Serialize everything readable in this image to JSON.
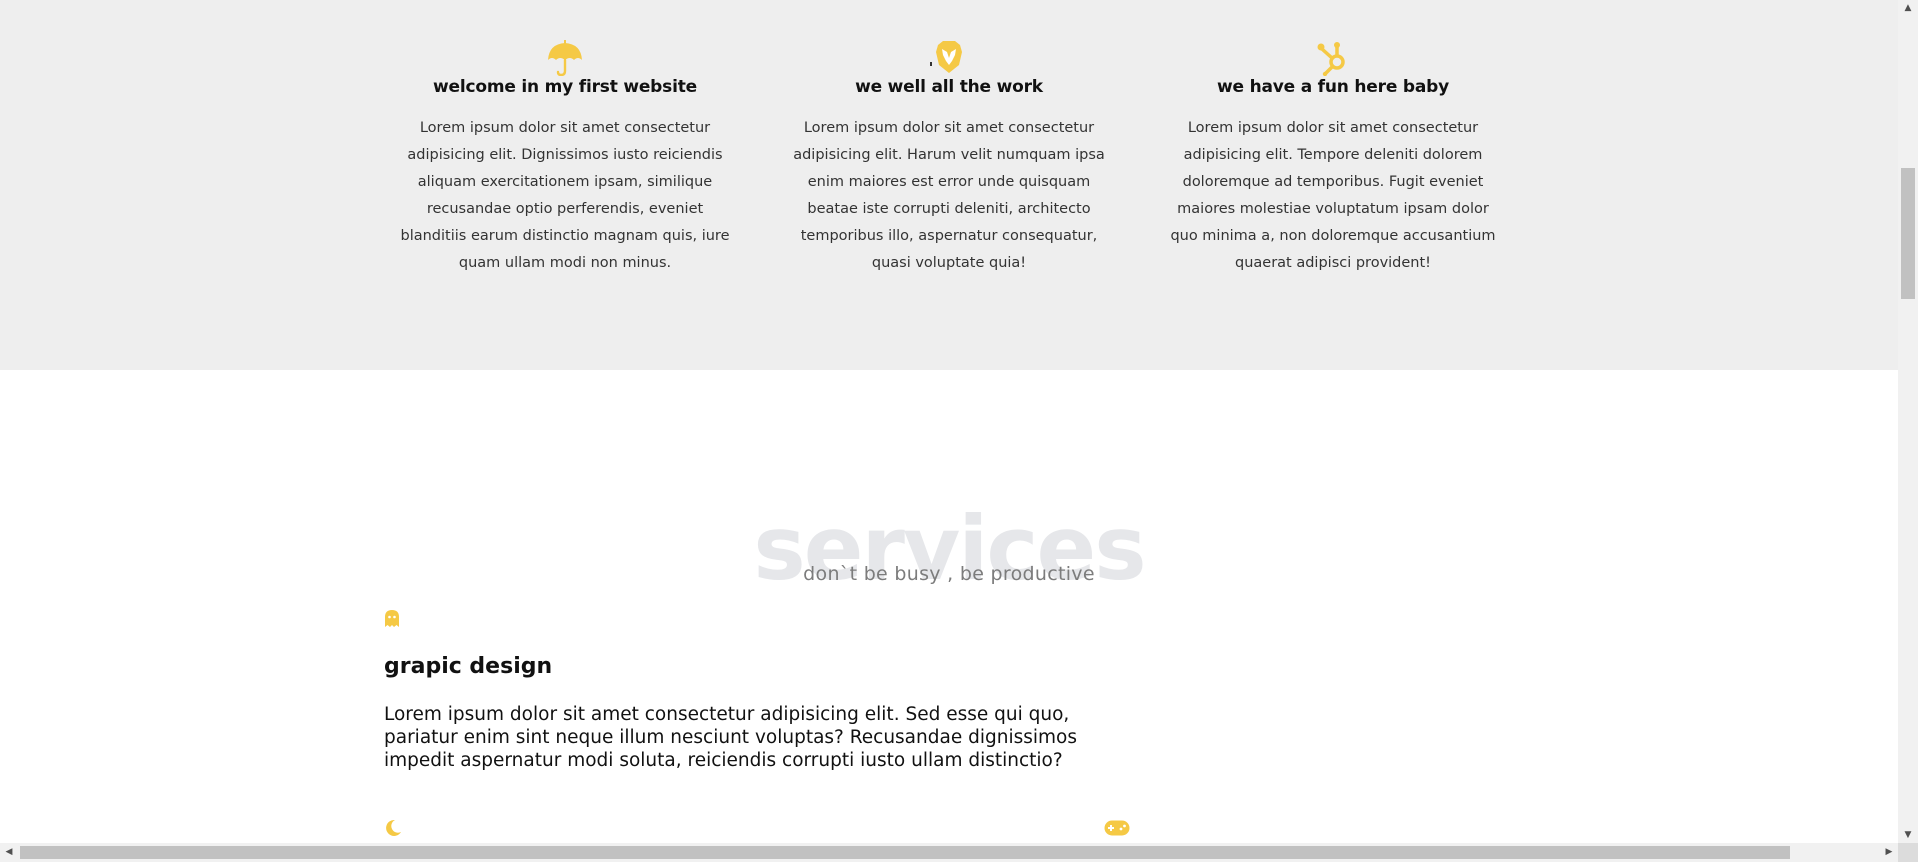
{
  "colors": {
    "accent": "#f5c945",
    "section_bg": "#eeeeee",
    "title_ghost": "#e6e7ea"
  },
  "features": [
    {
      "icon": "umbrella-icon",
      "title": "welcome in my first website",
      "text": "Lorem ipsum dolor sit amet consectetur adipisicing elit. Dignissimos iusto reiciendis aliquam exercitationem ipsam, similique recusandae optio perferendis, eveniet blanditiis earum distinctio magnam quis, iure quam ullam modi non minus."
    },
    {
      "icon": "lion-shield-icon",
      "title": "we well all the work",
      "text": "Lorem ipsum dolor sit amet consectetur adipisicing elit. Harum velit numquam ipsa enim maiores est error unde quisquam beatae iste corrupti deleniti, architecto temporibus illo, aspernatur consequatur, quasi voluptate quia!"
    },
    {
      "icon": "hubspot-icon",
      "title": "we have a fun here baby",
      "text": "Lorem ipsum dolor sit amet consectetur adipisicing elit. Tempore deleniti dolorem doloremque ad temporibus. Fugit eveniet maiores molestiae voluptatum ipsam dolor quo minima a, non doloremque accusantium quaerat adipisci provident!"
    }
  ],
  "services": {
    "title": "services",
    "subtitle": "don`t be busy , be productive",
    "items": [
      {
        "icon": "ghost-icon",
        "title": "grapic design",
        "text": "Lorem ipsum dolor sit amet consectetur adipisicing elit. Sed esse qui quo, pariatur enim sint neque illum nesciunt voluptas? Recusandae dignissimos impedit aspernatur modi soluta, reiciendis corrupti iusto ullam distinctio?"
      }
    ],
    "next_icons": [
      "moon-icon",
      "gamepad-icon"
    ]
  }
}
